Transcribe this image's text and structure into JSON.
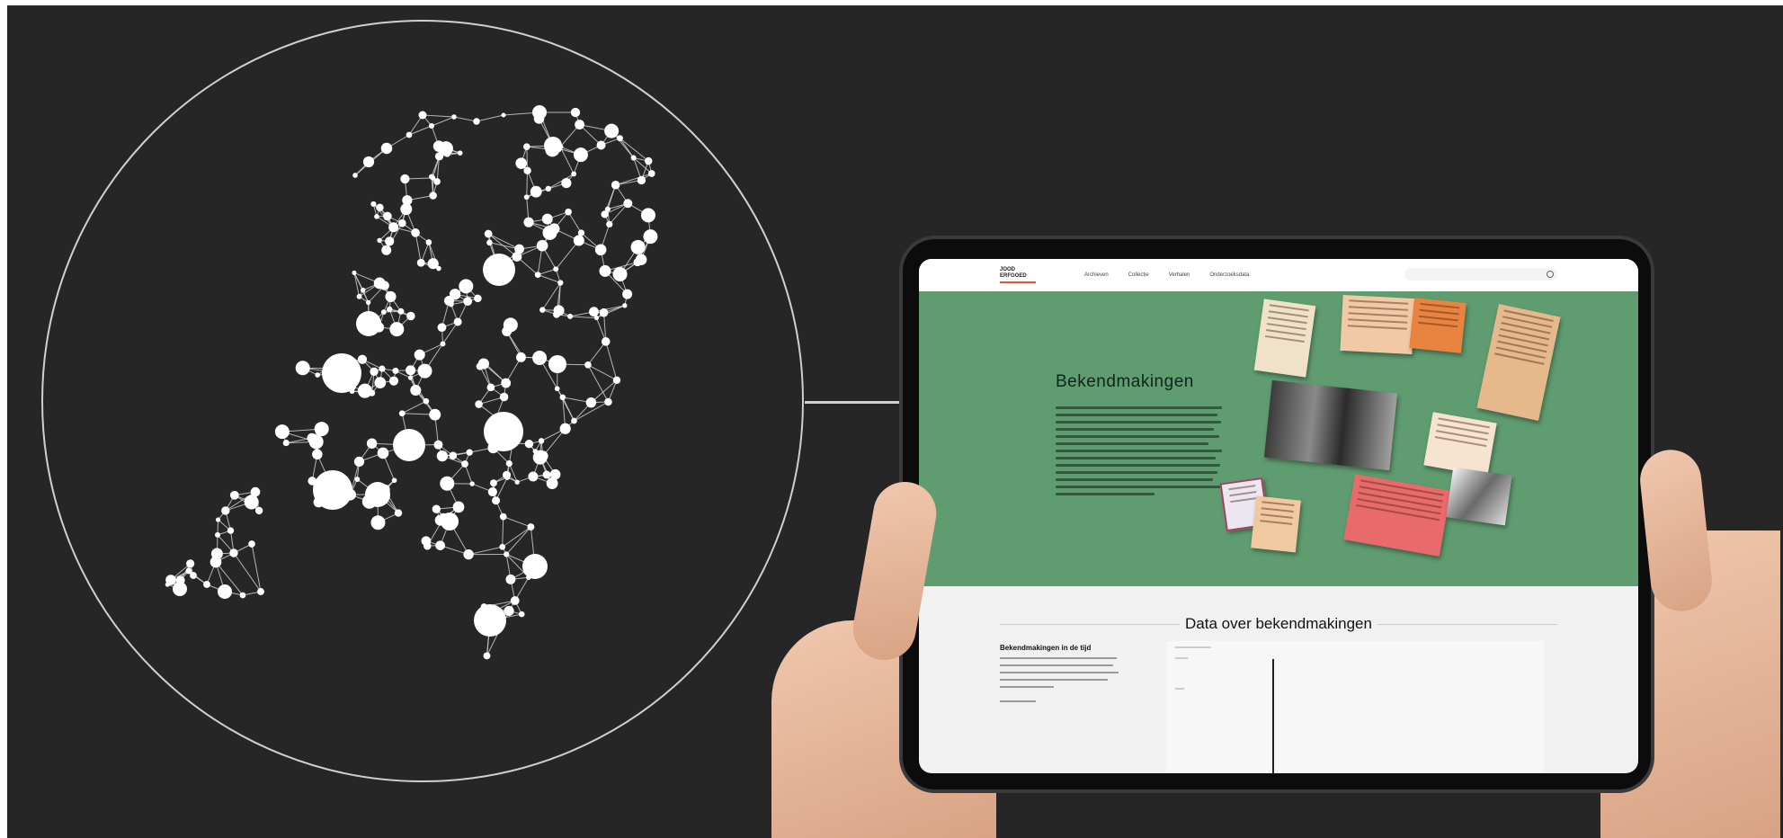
{
  "network": {
    "colors": {
      "line": "#d9d9d9",
      "node": "#ffffff",
      "circle": "#d0d0d0"
    }
  },
  "website": {
    "logo": [
      "JOOD",
      "ERFGOED"
    ],
    "nav": [
      "Archieven",
      "Collectie",
      "Verhalen",
      "Onderzoeksdata"
    ],
    "hero": {
      "title": "Bekendmakingen",
      "color": "#5f9c70"
    },
    "section": {
      "title": "Data over bekendmakingen",
      "subtitle": "Bekendmakingen in de tijd"
    }
  }
}
